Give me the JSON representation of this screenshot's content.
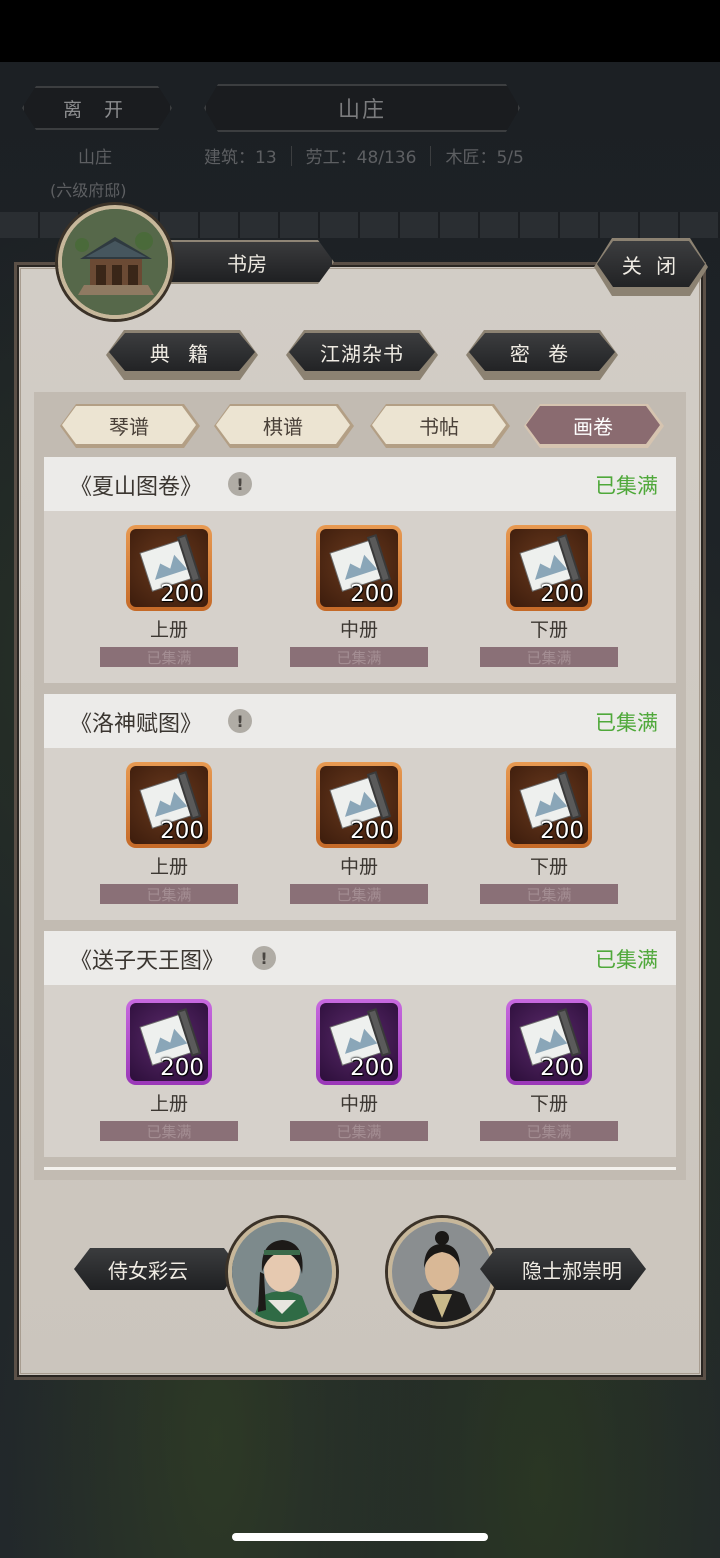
{
  "hud": {
    "leave_label": "离 开",
    "location_title": "山庄",
    "location_name": "山庄",
    "location_level": "(六级府邸)",
    "stats": [
      "建筑：13",
      "劳工：48/136",
      "木匠：5/5"
    ]
  },
  "panel": {
    "building_name": "书房",
    "close_label": "关 闭"
  },
  "categories": [
    {
      "label": "典 籍",
      "active": false
    },
    {
      "label": "江湖杂书",
      "active": false
    },
    {
      "label": "密 卷",
      "active": false
    }
  ],
  "sub_tabs": [
    {
      "label": "琴谱",
      "active": false
    },
    {
      "label": "棋谱",
      "active": false
    },
    {
      "label": "书帖",
      "active": false
    },
    {
      "label": "画卷",
      "active": true
    }
  ],
  "collections": [
    {
      "title": "《夏山图卷》",
      "status": "已集满",
      "rarity": "orange",
      "items": [
        {
          "label": "上册",
          "count": "200",
          "status": "已集满"
        },
        {
          "label": "中册",
          "count": "200",
          "status": "已集满"
        },
        {
          "label": "下册",
          "count": "200",
          "status": "已集满"
        }
      ]
    },
    {
      "title": "《洛神赋图》",
      "status": "已集满",
      "rarity": "orange",
      "items": [
        {
          "label": "上册",
          "count": "200",
          "status": "已集满"
        },
        {
          "label": "中册",
          "count": "200",
          "status": "已集满"
        },
        {
          "label": "下册",
          "count": "200",
          "status": "已集满"
        }
      ]
    },
    {
      "title": "《送子天王图》",
      "status": "已集满",
      "rarity": "purple",
      "items": [
        {
          "label": "上册",
          "count": "200",
          "status": "已集满"
        },
        {
          "label": "中册",
          "count": "200",
          "status": "已集满"
        },
        {
          "label": "下册",
          "count": "200",
          "status": "已集满"
        }
      ]
    }
  ],
  "info_glyph": "!",
  "characters": [
    {
      "name": "侍女彩云",
      "icon": "maid-portrait"
    },
    {
      "name": "隐士郝崇明",
      "icon": "hermit-portrait"
    }
  ],
  "colors": {
    "complete_green": "#4fa83a",
    "orange_frame": "#e08a40",
    "purple_frame": "#b450d0",
    "active_tab": "#8a6b70"
  }
}
